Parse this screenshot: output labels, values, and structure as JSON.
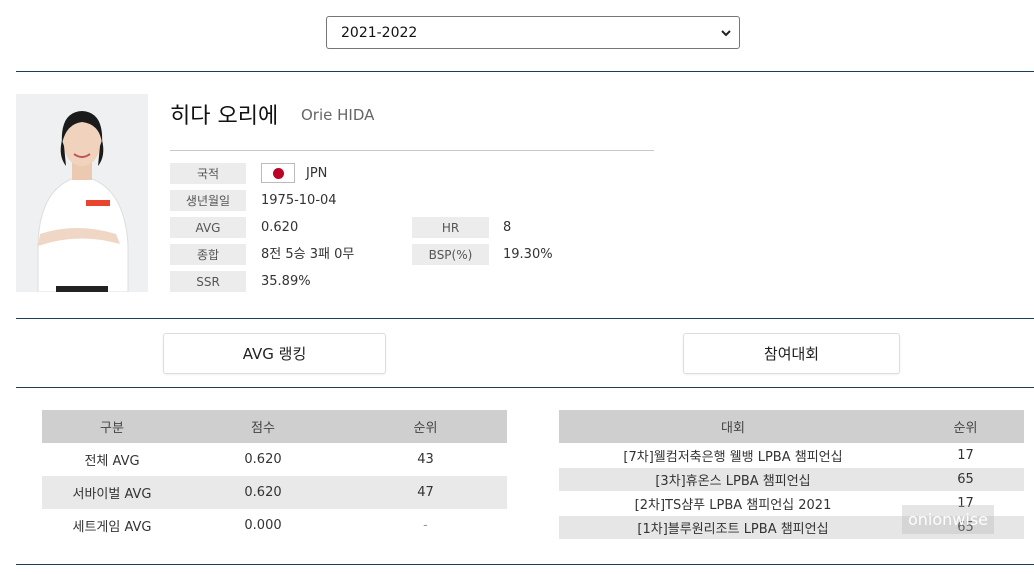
{
  "season_select": {
    "value": "2021-2022"
  },
  "player": {
    "name_ko": "히다 오리에",
    "name_en": "Orie HIDA",
    "fields": {
      "nationality_label": "국적",
      "nationality_value": "JPN",
      "birth_label": "생년월일",
      "birth_value": "1975-10-04",
      "avg_label": "AVG",
      "avg_value": "0.620",
      "hr_label": "HR",
      "hr_value": "8",
      "total_label": "종합",
      "total_value": "8전 5승 3패 0무",
      "bsp_label": "BSP(%)",
      "bsp_value": "19.30%",
      "ssr_label": "SSR",
      "ssr_value": "35.89%"
    },
    "flag_icon": "japan-flag-icon",
    "colors": {
      "flag_red": "#bc0026",
      "divider": "#1f3d57"
    }
  },
  "buttons": {
    "avg_ranking": "AVG 랭킹",
    "tournaments": "참여대회"
  },
  "avg_table": {
    "headers": [
      "구분",
      "점수",
      "순위"
    ],
    "rows": [
      [
        "전체 AVG",
        "0.620",
        "43"
      ],
      [
        "서바이벌 AVG",
        "0.620",
        "47"
      ],
      [
        "세트게임 AVG",
        "0.000",
        "-"
      ]
    ]
  },
  "tournament_table": {
    "headers": [
      "대회",
      "순위"
    ],
    "rows": [
      [
        "[7차]웰컴저축은행 웰뱅 LPBA 챔피언십",
        "17"
      ],
      [
        "[3차]휴온스 LPBA 챔피언십",
        "65"
      ],
      [
        "[2차]TS샴푸 LPBA 챔피언십 2021",
        "17"
      ],
      [
        "[1차]블루원리조트 LPBA 챔피언십",
        "65"
      ]
    ]
  },
  "watermark": "onionwise"
}
